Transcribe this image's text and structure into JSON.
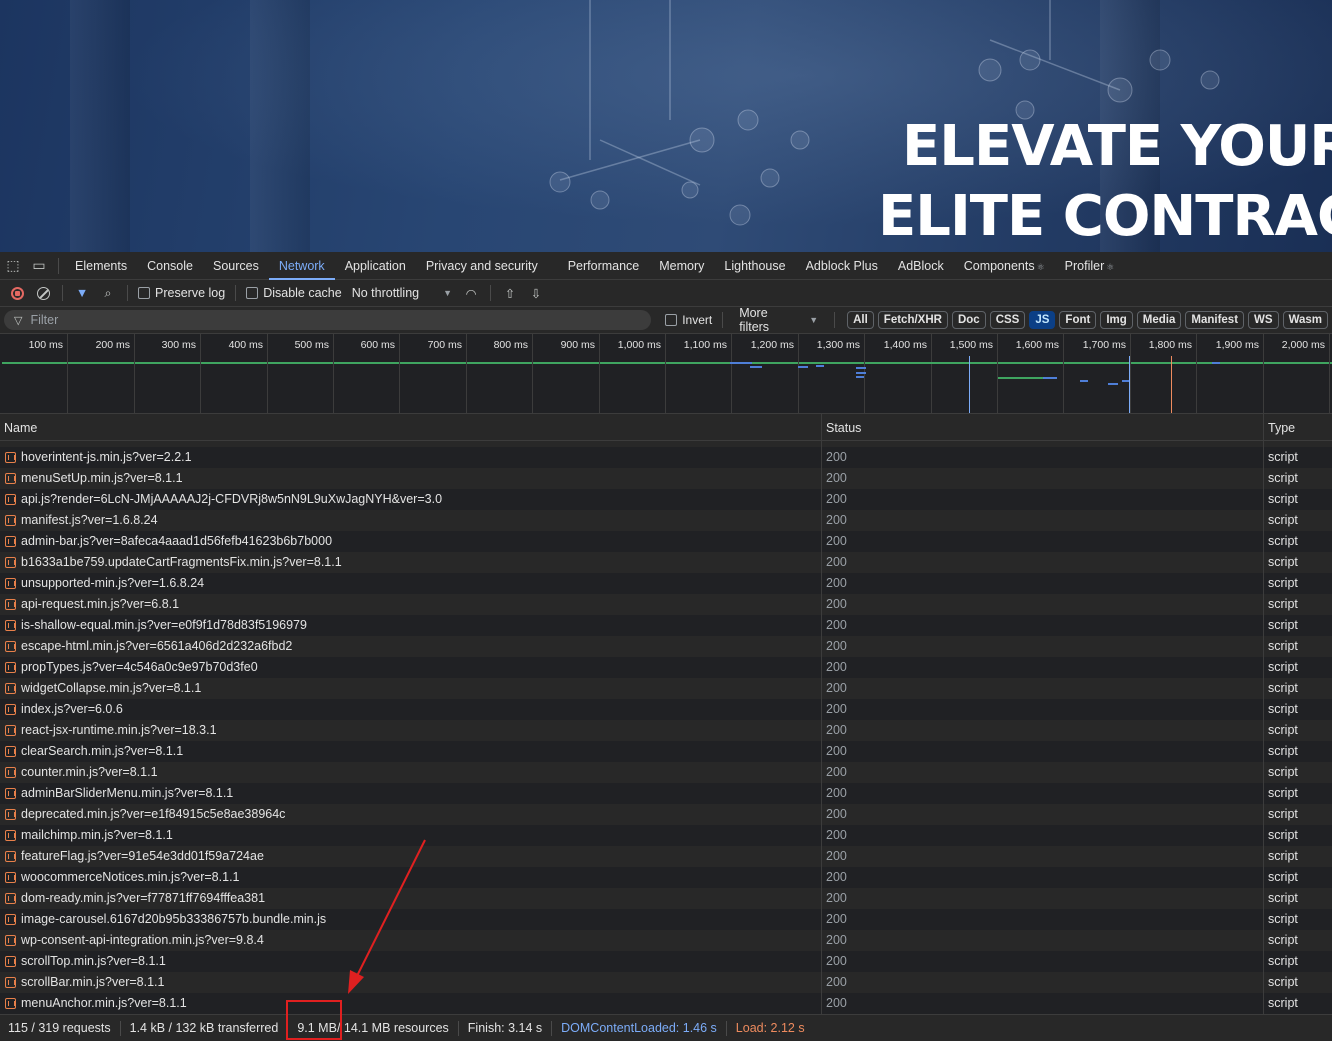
{
  "hero": {
    "line1": "ELEVATE YOUR S",
    "line2": "ELITE CONTRACT"
  },
  "tabs": [
    "Elements",
    "Console",
    "Sources",
    "Network",
    "Application",
    "Privacy and security",
    "Performance",
    "Memory",
    "Lighthouse",
    "Adblock Plus",
    "AdBlock",
    "Components",
    "Profiler"
  ],
  "active_tab": "Network",
  "toolbar": {
    "preserve_log": "Preserve log",
    "disable_cache": "Disable cache",
    "throttling": "No throttling"
  },
  "filter": {
    "placeholder": "Filter",
    "invert": "Invert",
    "more_filters": "More filters",
    "chips": [
      "All",
      "Fetch/XHR",
      "Doc",
      "CSS",
      "JS",
      "Font",
      "Img",
      "Media",
      "Manifest",
      "WS",
      "Wasm"
    ],
    "active_chip": "JS"
  },
  "timeline": {
    "ticks": [
      "100 ms",
      "200 ms",
      "300 ms",
      "400 ms",
      "500 ms",
      "600 ms",
      "700 ms",
      "800 ms",
      "900 ms",
      "1,000 ms",
      "1,100 ms",
      "1,200 ms",
      "1,300 ms",
      "1,400 ms",
      "1,500 ms",
      "1,600 ms",
      "1,700 ms",
      "1,800 ms",
      "1,900 ms",
      "2,000 ms"
    ]
  },
  "columns": {
    "name": "Name",
    "status": "Status",
    "type": "Type"
  },
  "requests": [
    {
      "name": "hoverintent-js.min.js?ver=2.2.1",
      "status": "200",
      "type": "script"
    },
    {
      "name": "menuSetUp.min.js?ver=8.1.1",
      "status": "200",
      "type": "script"
    },
    {
      "name": "api.js?render=6LcN-JMjAAAAAJ2j-CFDVRj8w5nN9L9uXwJagNYH&ver=3.0",
      "status": "200",
      "type": "script"
    },
    {
      "name": "manifest.js?ver=1.6.8.24",
      "status": "200",
      "type": "script"
    },
    {
      "name": "admin-bar.js?ver=8afeca4aaad1d56fefb41623b6b7b000",
      "status": "200",
      "type": "script"
    },
    {
      "name": "b1633a1be759.updateCartFragmentsFix.min.js?ver=8.1.1",
      "status": "200",
      "type": "script"
    },
    {
      "name": "unsupported-min.js?ver=1.6.8.24",
      "status": "200",
      "type": "script"
    },
    {
      "name": "api-request.min.js?ver=6.8.1",
      "status": "200",
      "type": "script"
    },
    {
      "name": "is-shallow-equal.min.js?ver=e0f9f1d78d83f5196979",
      "status": "200",
      "type": "script"
    },
    {
      "name": "escape-html.min.js?ver=6561a406d2d232a6fbd2",
      "status": "200",
      "type": "script"
    },
    {
      "name": "propTypes.js?ver=4c546a0c9e97b70d3fe0",
      "status": "200",
      "type": "script"
    },
    {
      "name": "widgetCollapse.min.js?ver=8.1.1",
      "status": "200",
      "type": "script"
    },
    {
      "name": "index.js?ver=6.0.6",
      "status": "200",
      "type": "script"
    },
    {
      "name": "react-jsx-runtime.min.js?ver=18.3.1",
      "status": "200",
      "type": "script"
    },
    {
      "name": "clearSearch.min.js?ver=8.1.1",
      "status": "200",
      "type": "script"
    },
    {
      "name": "counter.min.js?ver=8.1.1",
      "status": "200",
      "type": "script"
    },
    {
      "name": "adminBarSliderMenu.min.js?ver=8.1.1",
      "status": "200",
      "type": "script"
    },
    {
      "name": "deprecated.min.js?ver=e1f84915c5e8ae38964c",
      "status": "200",
      "type": "script"
    },
    {
      "name": "mailchimp.min.js?ver=8.1.1",
      "status": "200",
      "type": "script"
    },
    {
      "name": "featureFlag.js?ver=91e54e3dd01f59a724ae",
      "status": "200",
      "type": "script"
    },
    {
      "name": "woocommerceNotices.min.js?ver=8.1.1",
      "status": "200",
      "type": "script"
    },
    {
      "name": "dom-ready.min.js?ver=f77871ff7694fffea381",
      "status": "200",
      "type": "script"
    },
    {
      "name": "image-carousel.6167d20b95b33386757b.bundle.min.js",
      "status": "200",
      "type": "script"
    },
    {
      "name": "wp-consent-api-integration.min.js?ver=9.8.4",
      "status": "200",
      "type": "script"
    },
    {
      "name": "scrollTop.min.js?ver=8.1.1",
      "status": "200",
      "type": "script"
    },
    {
      "name": "scrollBar.min.js?ver=8.1.1",
      "status": "200",
      "type": "script"
    },
    {
      "name": "menuAnchor.min.js?ver=8.1.1",
      "status": "200",
      "type": "script"
    }
  ],
  "summary": {
    "requests": "115 / 319 requests",
    "transferred": "1.4 kB / 132 kB transferred",
    "resources_a": "9.1 MB",
    "resources_b": " / 14.1 MB resources",
    "finish": "Finish: 3.14 s",
    "dcl": "DOMContentLoaded: 1.46 s",
    "load": "Load: 2.12 s"
  },
  "colors": {
    "accent": "#7cacf8",
    "annotation": "#e02020",
    "dcl": "#7cacf8",
    "load": "#ee8b5e"
  }
}
